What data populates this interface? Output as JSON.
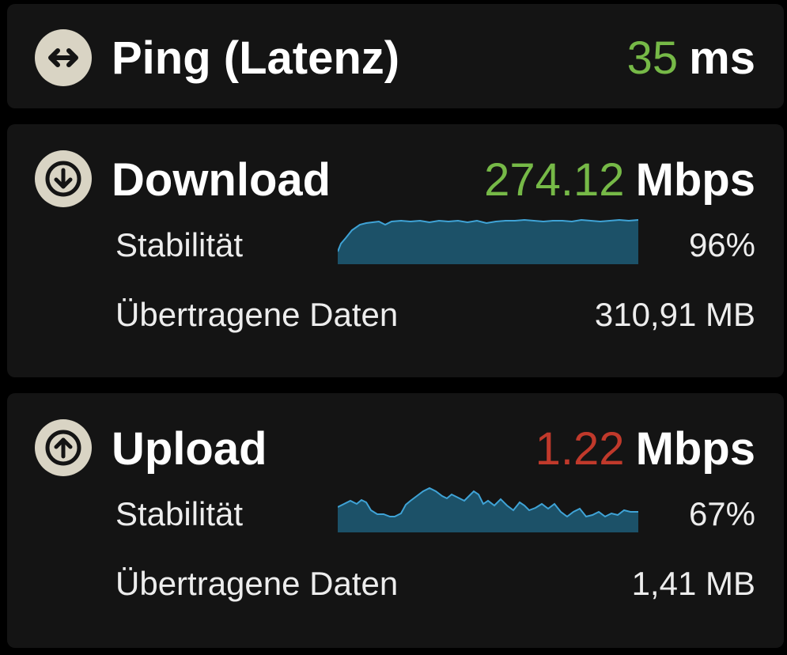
{
  "colors": {
    "good": "#76b947",
    "bad": "#c0392b",
    "chart_fill": "#1c5168",
    "chart_line": "#3fa3d6",
    "icon_bg": "#d9d4c4"
  },
  "ping": {
    "icon": "horizontal-double-arrow-icon",
    "title": "Ping (Latenz)",
    "value": "35",
    "unit": "ms"
  },
  "download": {
    "icon": "arrow-down-circle-icon",
    "title": "Download",
    "value": "274.12",
    "unit": "Mbps",
    "stability_label": "Stabilität",
    "stability_value": "96%",
    "stability_level": 0.96,
    "data_label": "Übertragene Daten",
    "data_value": "310,91 MB"
  },
  "upload": {
    "icon": "arrow-up-circle-icon",
    "title": "Upload",
    "value": "1.22",
    "unit": "Mbps",
    "stability_label": "Stabilität",
    "stability_value": "67%",
    "stability_level": 0.67,
    "data_label": "Übertragene Daten",
    "data_value": "1,41 MB"
  }
}
